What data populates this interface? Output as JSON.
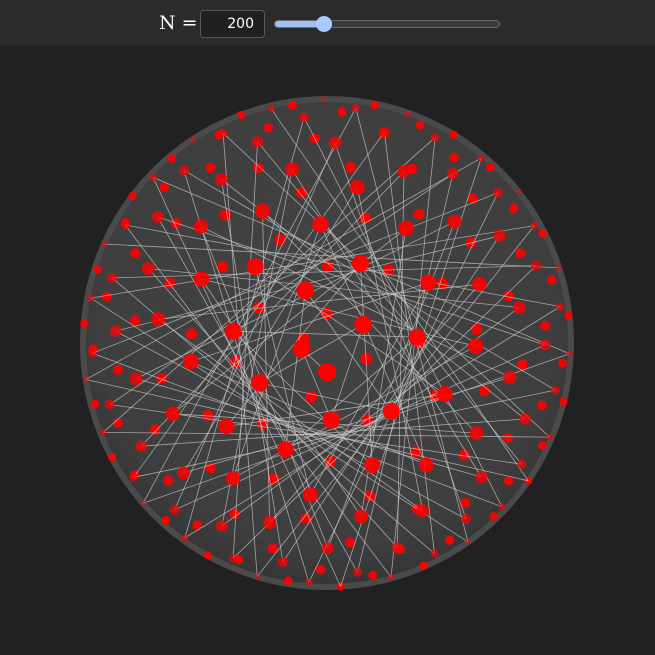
{
  "controls": {
    "n_label": "N =",
    "n_value": "200",
    "slider": {
      "min": 0,
      "max": 1000,
      "value": 200
    }
  },
  "scene": {
    "point_count": 200,
    "sphere_color": "#404040",
    "point_color": "#ff0000",
    "edge_color": "#c8c8c8",
    "background": "#212121"
  }
}
